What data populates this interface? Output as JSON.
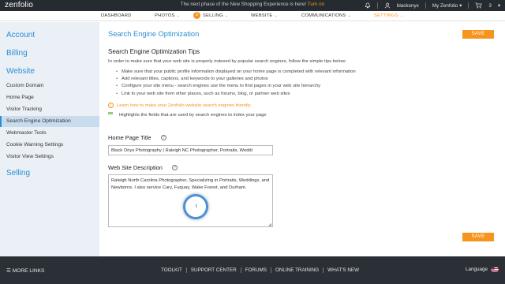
{
  "top_bar": {
    "logo": "zenfolio",
    "announcement": "The next phase of the New Shopping Experience is here!",
    "announcement_link": "Turn on",
    "username": "blackonyx",
    "account_menu": "My Zenfolio",
    "cart_count": "3",
    "icons": [
      "bell-icon",
      "user-icon",
      "cart-icon"
    ]
  },
  "nav": {
    "items": [
      {
        "label": "DASHBOARD"
      },
      {
        "label": "PHOTOS"
      },
      {
        "label": "SELLING",
        "badge": "3"
      },
      {
        "label": "WEBSITE"
      },
      {
        "label": "COMMUNICATIONS"
      },
      {
        "label": "SETTINGS"
      }
    ],
    "active": "SETTINGS"
  },
  "sidebar": {
    "sections": [
      {
        "label": "Account"
      },
      {
        "label": "Billing"
      },
      {
        "label": "Website"
      },
      {
        "label": "Selling"
      }
    ],
    "website_items": [
      {
        "label": "Custom Domain"
      },
      {
        "label": "Home Page"
      },
      {
        "label": "Visitor Tracking"
      },
      {
        "label": "Search Engine Optimization"
      },
      {
        "label": "Webmaster Tools"
      },
      {
        "label": "Cookie Warning Settings"
      },
      {
        "label": "Visitor View Settings"
      }
    ],
    "active_item": "Search Engine Optimization"
  },
  "main": {
    "title": "Search Engine Optimization",
    "save_label": "SAVE",
    "tips_title": "Search Engine Optimization Tips",
    "tips_intro": "In order to make sure that your web site is properly indexed by popular search engines, follow the simple tips below:",
    "tips": [
      "Make sure that your public profile information displayed on your home page is completed with relevant information",
      "Add relevant titles, captions, and keywords to your galleries and photos",
      "Configure your site menu - search engines use the menu to find pages in your web site hierarchy",
      "Link to your web site from other places, such as forums, blog, or partner web sites"
    ],
    "learn_link": "Learn how to make your Zenfolio website search engines friendly",
    "highlight_note": "Highlights the fields that are used by search engines to index your page",
    "home_page_title_label": "Home Page Title",
    "home_page_title_value": "Black Onyx Photography | Raleigh NC Photographer, Portraits, Weddi",
    "description_label": "Web Site Description",
    "description_value": "Raleigh North Carolina Photographer, Specializing in Portraits, Weddings, and Newborns. I also service Cary, Fuquay, Wake Forest, and Durham."
  },
  "footer": {
    "more_links": "MORE LINKS",
    "links": [
      "TOOLKIT",
      "SUPPORT CENTER",
      "FORUMS",
      "ONLINE TRAINING",
      "WHAT'S NEW"
    ],
    "language_label": "Language"
  },
  "colors": {
    "accent": "#f7941d",
    "link_blue": "#2b8fd6",
    "sidebar_bg": "#eaf0f6",
    "footer_bg": "#2b3036"
  }
}
